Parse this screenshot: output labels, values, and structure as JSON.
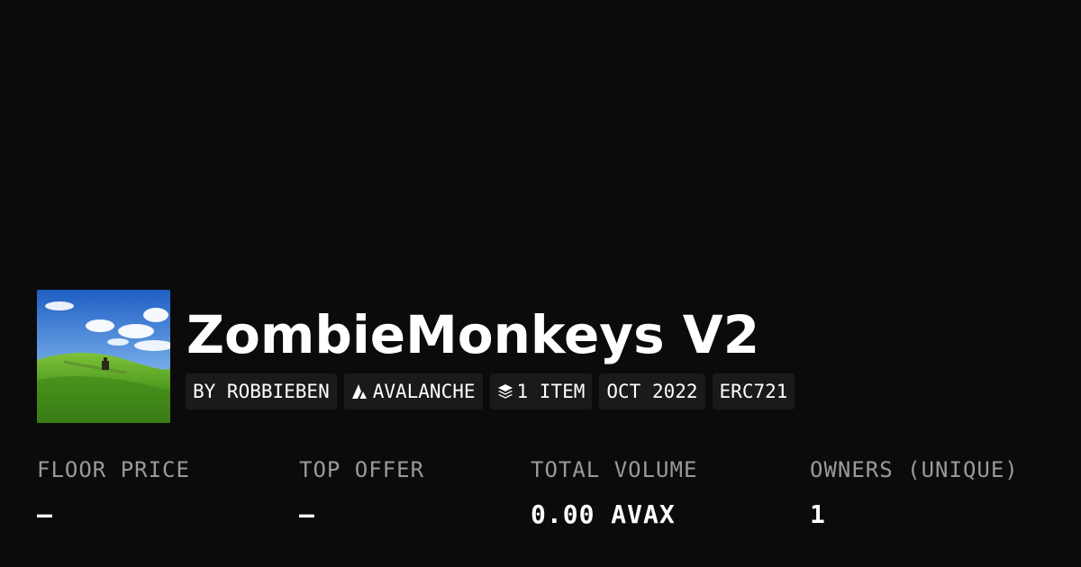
{
  "collection": {
    "name": "ZombieMonkeys V2",
    "image_alt": "collection-image"
  },
  "badges": {
    "creator": "BY ROBBIEBEN",
    "chain": "AVALANCHE",
    "chain_icon": "avalanche-logo-icon",
    "items": "1 ITEM",
    "items_icon": "layers-icon",
    "date": "OCT 2022",
    "standard": "ERC721"
  },
  "stats": {
    "floor_price": {
      "label": "FLOOR PRICE",
      "value": "—"
    },
    "top_offer": {
      "label": "TOP OFFER",
      "value": "—"
    },
    "total_volume": {
      "label": "TOTAL VOLUME",
      "value": "0.00 AVAX"
    },
    "owners": {
      "label": "OWNERS (UNIQUE)",
      "value": "1"
    }
  },
  "colors": {
    "background": "#0b0b0b",
    "badge_background": "#1a1a1a",
    "label": "#9a9a9a",
    "text": "#ffffff"
  }
}
